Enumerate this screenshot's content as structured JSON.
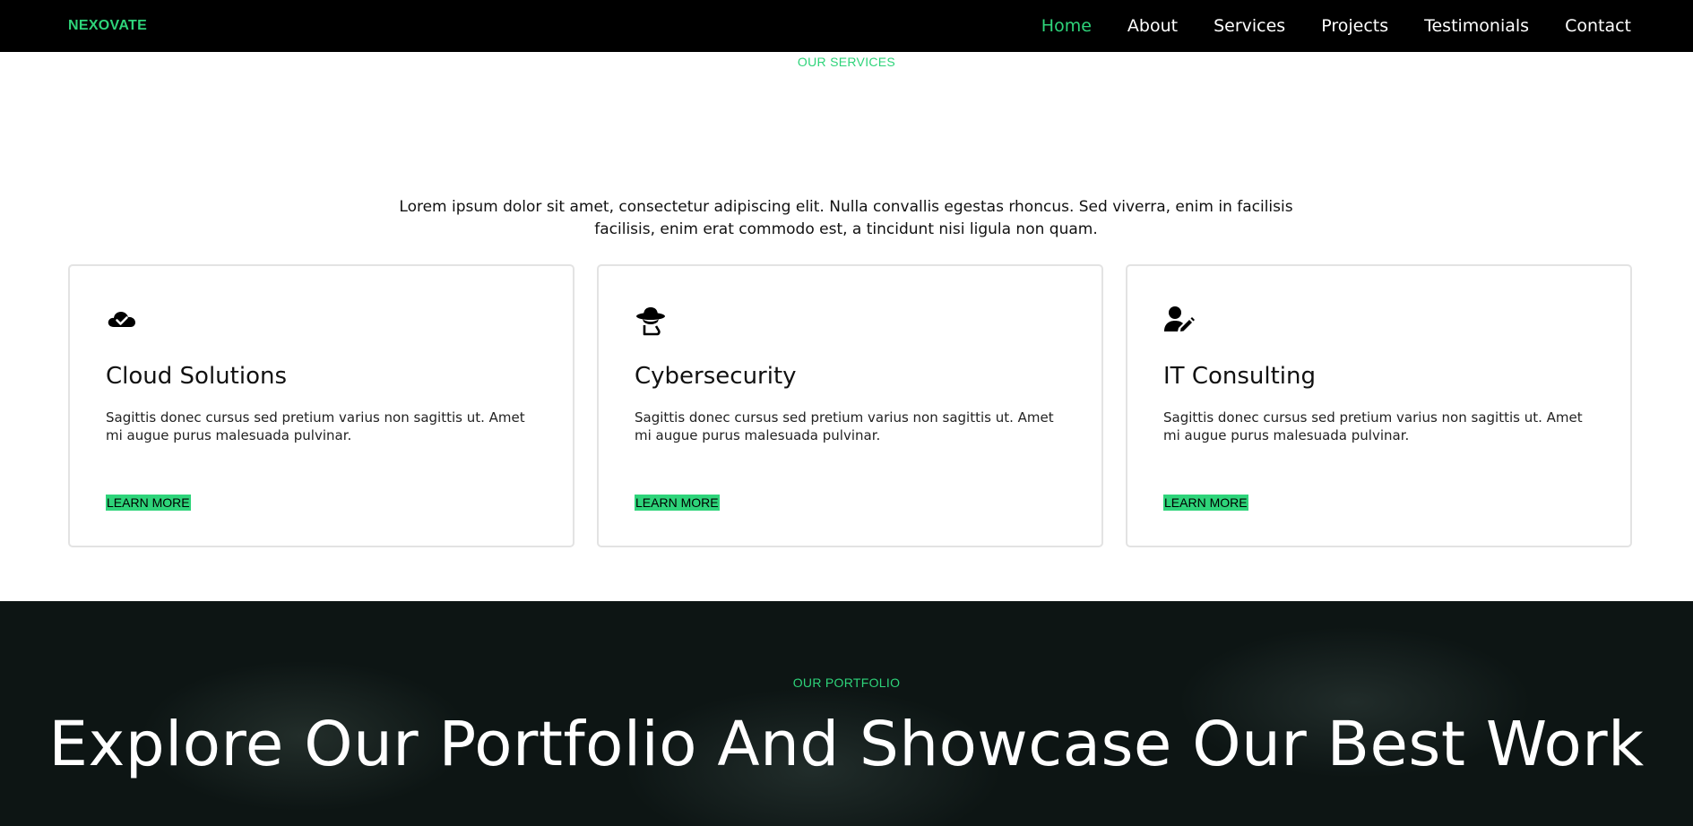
{
  "colors": {
    "accent": "#2ed47a",
    "nav_bg": "#000000",
    "portfolio_bg": "#0d1514"
  },
  "navbar": {
    "brand": "NEXOVATE",
    "links": [
      {
        "label": "Home",
        "active": true
      },
      {
        "label": "About"
      },
      {
        "label": "Services"
      },
      {
        "label": "Projects"
      },
      {
        "label": "Testimonials"
      },
      {
        "label": "Contact"
      }
    ]
  },
  "services": {
    "eyebrow": "OUR SERVICES",
    "intro": "Lorem ipsum dolor sit amet, consectetur adipiscing elit. Nulla convallis egestas rhoncus. Sed viverra, enim in facilisis facilisis, enim erat commodo est, a tincidunt nisi ligula non quam.",
    "cards": [
      {
        "icon": "cloud-check-icon",
        "title": "Cloud Solutions",
        "text": "Sagittis donec cursus sed pretium varius non sagittis ut. Amet mi augue purus malesuada pulvinar.",
        "link": "LEARN MORE"
      },
      {
        "icon": "user-secret-icon",
        "title": "Cybersecurity",
        "text": "Sagittis donec cursus sed pretium varius non sagittis ut. Amet mi augue purus malesuada pulvinar.",
        "link": "LEARN MORE"
      },
      {
        "icon": "user-edit-icon",
        "title": "IT Consulting",
        "text": "Sagittis donec cursus sed pretium varius non sagittis ut. Amet mi augue purus malesuada pulvinar.",
        "link": "LEARN MORE"
      }
    ]
  },
  "portfolio": {
    "eyebrow": "OUR PORTFOLIO",
    "title": "Explore Our Portfolio And Showcase Our Best Work"
  }
}
